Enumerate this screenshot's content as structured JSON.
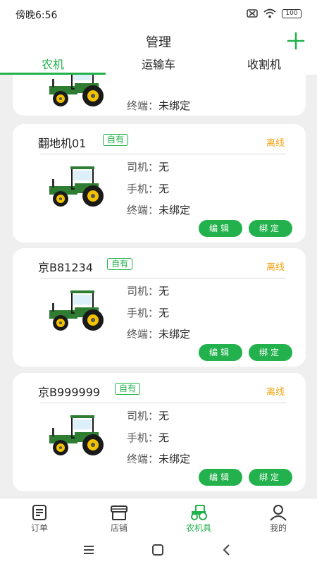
{
  "status_bar": {
    "time": "傍晚6:56",
    "battery": "100"
  },
  "header": {
    "title": "管理",
    "add_icon": "plus-icon"
  },
  "tabs": [
    {
      "label": "农机",
      "active": true
    },
    {
      "label": "运输车",
      "active": false
    },
    {
      "label": "收割机",
      "active": false
    }
  ],
  "labels": {
    "driver": "司机：",
    "phone": "手机：",
    "terminal": "终端："
  },
  "buttons": {
    "edit": "编辑",
    "bind": "绑定"
  },
  "cards": [
    {
      "title": "",
      "badge": "",
      "status": "",
      "driver": "",
      "phone": "",
      "terminal": "未绑定"
    },
    {
      "title": "翻地机01",
      "badge": "自有",
      "status": "离线",
      "driver": "无",
      "phone": "无",
      "terminal": "未绑定"
    },
    {
      "title": "京B81234",
      "badge": "自有",
      "status": "离线",
      "driver": "无",
      "phone": "无",
      "terminal": "未绑定"
    },
    {
      "title": "京B999999",
      "badge": "自有",
      "status": "离线",
      "driver": "无",
      "phone": "无",
      "terminal": "未绑定"
    }
  ],
  "bottom_nav": [
    {
      "label": "订单",
      "icon": "order-icon",
      "active": false
    },
    {
      "label": "店铺",
      "icon": "store-icon",
      "active": false
    },
    {
      "label": "农机具",
      "icon": "tractor-icon",
      "active": true
    },
    {
      "label": "我的",
      "icon": "user-icon",
      "active": false
    }
  ],
  "colors": {
    "accent": "#22b14c",
    "offline": "#f2a516"
  }
}
